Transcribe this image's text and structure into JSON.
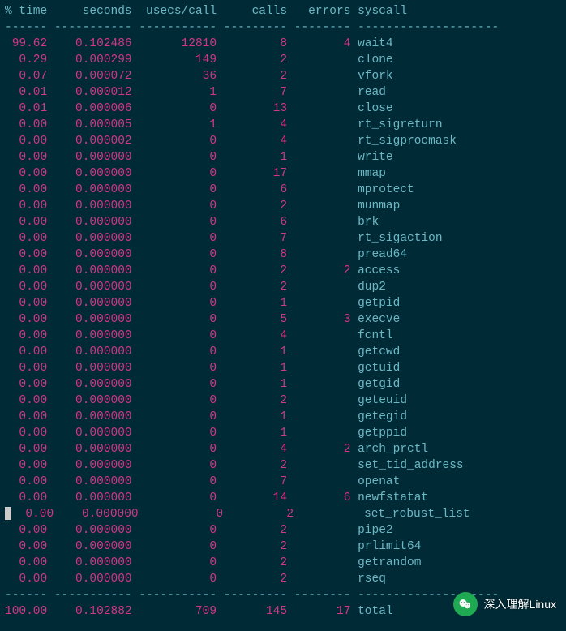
{
  "headers": [
    "% time",
    "seconds",
    "usecs/call",
    "calls",
    "errors",
    "syscall"
  ],
  "rows": [
    {
      "time": "99.62",
      "seconds": "0.102486",
      "usecs": "12810",
      "calls": "8",
      "errors": "4",
      "syscall": "wait4"
    },
    {
      "time": "0.29",
      "seconds": "0.000299",
      "usecs": "149",
      "calls": "2",
      "errors": "",
      "syscall": "clone"
    },
    {
      "time": "0.07",
      "seconds": "0.000072",
      "usecs": "36",
      "calls": "2",
      "errors": "",
      "syscall": "vfork"
    },
    {
      "time": "0.01",
      "seconds": "0.000012",
      "usecs": "1",
      "calls": "7",
      "errors": "",
      "syscall": "read"
    },
    {
      "time": "0.01",
      "seconds": "0.000006",
      "usecs": "0",
      "calls": "13",
      "errors": "",
      "syscall": "close"
    },
    {
      "time": "0.00",
      "seconds": "0.000005",
      "usecs": "1",
      "calls": "4",
      "errors": "",
      "syscall": "rt_sigreturn"
    },
    {
      "time": "0.00",
      "seconds": "0.000002",
      "usecs": "0",
      "calls": "4",
      "errors": "",
      "syscall": "rt_sigprocmask"
    },
    {
      "time": "0.00",
      "seconds": "0.000000",
      "usecs": "0",
      "calls": "1",
      "errors": "",
      "syscall": "write"
    },
    {
      "time": "0.00",
      "seconds": "0.000000",
      "usecs": "0",
      "calls": "17",
      "errors": "",
      "syscall": "mmap"
    },
    {
      "time": "0.00",
      "seconds": "0.000000",
      "usecs": "0",
      "calls": "6",
      "errors": "",
      "syscall": "mprotect"
    },
    {
      "time": "0.00",
      "seconds": "0.000000",
      "usecs": "0",
      "calls": "2",
      "errors": "",
      "syscall": "munmap"
    },
    {
      "time": "0.00",
      "seconds": "0.000000",
      "usecs": "0",
      "calls": "6",
      "errors": "",
      "syscall": "brk"
    },
    {
      "time": "0.00",
      "seconds": "0.000000",
      "usecs": "0",
      "calls": "7",
      "errors": "",
      "syscall": "rt_sigaction"
    },
    {
      "time": "0.00",
      "seconds": "0.000000",
      "usecs": "0",
      "calls": "8",
      "errors": "",
      "syscall": "pread64"
    },
    {
      "time": "0.00",
      "seconds": "0.000000",
      "usecs": "0",
      "calls": "2",
      "errors": "2",
      "syscall": "access"
    },
    {
      "time": "0.00",
      "seconds": "0.000000",
      "usecs": "0",
      "calls": "2",
      "errors": "",
      "syscall": "dup2"
    },
    {
      "time": "0.00",
      "seconds": "0.000000",
      "usecs": "0",
      "calls": "1",
      "errors": "",
      "syscall": "getpid"
    },
    {
      "time": "0.00",
      "seconds": "0.000000",
      "usecs": "0",
      "calls": "5",
      "errors": "3",
      "syscall": "execve"
    },
    {
      "time": "0.00",
      "seconds": "0.000000",
      "usecs": "0",
      "calls": "4",
      "errors": "",
      "syscall": "fcntl"
    },
    {
      "time": "0.00",
      "seconds": "0.000000",
      "usecs": "0",
      "calls": "1",
      "errors": "",
      "syscall": "getcwd"
    },
    {
      "time": "0.00",
      "seconds": "0.000000",
      "usecs": "0",
      "calls": "1",
      "errors": "",
      "syscall": "getuid"
    },
    {
      "time": "0.00",
      "seconds": "0.000000",
      "usecs": "0",
      "calls": "1",
      "errors": "",
      "syscall": "getgid"
    },
    {
      "time": "0.00",
      "seconds": "0.000000",
      "usecs": "0",
      "calls": "2",
      "errors": "",
      "syscall": "geteuid"
    },
    {
      "time": "0.00",
      "seconds": "0.000000",
      "usecs": "0",
      "calls": "1",
      "errors": "",
      "syscall": "getegid"
    },
    {
      "time": "0.00",
      "seconds": "0.000000",
      "usecs": "0",
      "calls": "1",
      "errors": "",
      "syscall": "getppid"
    },
    {
      "time": "0.00",
      "seconds": "0.000000",
      "usecs": "0",
      "calls": "4",
      "errors": "2",
      "syscall": "arch_prctl"
    },
    {
      "time": "0.00",
      "seconds": "0.000000",
      "usecs": "0",
      "calls": "2",
      "errors": "",
      "syscall": "set_tid_address"
    },
    {
      "time": "0.00",
      "seconds": "0.000000",
      "usecs": "0",
      "calls": "7",
      "errors": "",
      "syscall": "openat"
    },
    {
      "time": "0.00",
      "seconds": "0.000000",
      "usecs": "0",
      "calls": "14",
      "errors": "6",
      "syscall": "newfstatat"
    },
    {
      "time": "0.00",
      "seconds": "0.000000",
      "usecs": "0",
      "calls": "2",
      "errors": "",
      "syscall": "set_robust_list"
    },
    {
      "time": "0.00",
      "seconds": "0.000000",
      "usecs": "0",
      "calls": "2",
      "errors": "",
      "syscall": "pipe2"
    },
    {
      "time": "0.00",
      "seconds": "0.000000",
      "usecs": "0",
      "calls": "2",
      "errors": "",
      "syscall": "prlimit64"
    },
    {
      "time": "0.00",
      "seconds": "0.000000",
      "usecs": "0",
      "calls": "2",
      "errors": "",
      "syscall": "getrandom"
    },
    {
      "time": "0.00",
      "seconds": "0.000000",
      "usecs": "0",
      "calls": "2",
      "errors": "",
      "syscall": "rseq"
    }
  ],
  "total": {
    "time": "100.00",
    "seconds": "0.102882",
    "usecs": "709",
    "calls": "145",
    "errors": "17",
    "syscall": "total"
  },
  "cursor_row": 29,
  "watermark_text": "深入理解Linux",
  "chart_data": {
    "type": "table",
    "title": "strace summary (-c) output",
    "columns": [
      "% time",
      "seconds",
      "usecs/call",
      "calls",
      "errors",
      "syscall"
    ]
  }
}
